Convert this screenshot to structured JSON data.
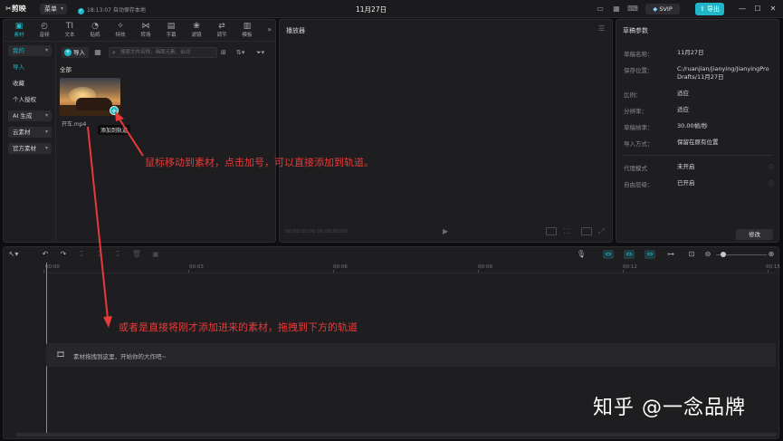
{
  "titlebar": {
    "app_name": "剪映",
    "menu_label": "菜单",
    "autosave_text": "18:13:07 自动保存本地",
    "doc_title": "11月27日",
    "svip_label": "SVIP",
    "export_label": "导出",
    "icons": [
      "monitor-icon",
      "layout-icon",
      "shortcut-icon"
    ],
    "window_controls": [
      "minimize-icon",
      "maximize-icon",
      "close-icon"
    ]
  },
  "media_tabs": [
    {
      "label": "素材",
      "icon": "media-icon",
      "active": true
    },
    {
      "label": "音频",
      "icon": "audio-icon"
    },
    {
      "label": "文本",
      "icon": "text-icon"
    },
    {
      "label": "贴纸",
      "icon": "sticker-icon"
    },
    {
      "label": "特效",
      "icon": "effects-icon"
    },
    {
      "label": "转场",
      "icon": "transition-icon"
    },
    {
      "label": "字幕",
      "icon": "subtitle-icon"
    },
    {
      "label": "滤镜",
      "icon": "filter-icon"
    },
    {
      "label": "调节",
      "icon": "adjust-icon"
    },
    {
      "label": "模板",
      "icon": "template-icon"
    }
  ],
  "side_nav": [
    {
      "label": "我的",
      "dropdown": true
    },
    {
      "label": "导入",
      "active": true
    },
    {
      "label": "收藏"
    },
    {
      "label": "个人授权"
    },
    {
      "label": "AI 生成",
      "dropdown": true
    },
    {
      "label": "云素材",
      "dropdown": true
    },
    {
      "label": "官方素材",
      "dropdown": true
    }
  ],
  "media_toolbar": {
    "import_label": "导入",
    "search_placeholder": "搜索文件名称、画面元素、台词"
  },
  "media": {
    "section_label": "全部",
    "clip_name": "开车.mp4",
    "tooltip": "添加到轨道"
  },
  "player": {
    "title": "播放器",
    "timecode": "00:00:00:00  00:00:00:00"
  },
  "props": {
    "title": "草稿参数",
    "rows": [
      {
        "key": "草稿名称：",
        "value": "11月27日"
      },
      {
        "key": "保存位置：",
        "value": "C:/ruanjian/jianying/JianyingPro Drafts/11月27日"
      },
      {
        "key": "比例：",
        "value": "适应"
      },
      {
        "key": "分辨率：",
        "value": "适应"
      },
      {
        "key": "草稿帧率：",
        "value": "30.00帧/秒"
      },
      {
        "key": "导入方式：",
        "value": "保留在原有位置"
      },
      {
        "key": "代理模式",
        "value": "未开启"
      },
      {
        "key": "自由层级：",
        "value": "已开启"
      }
    ],
    "modify_label": "修改"
  },
  "timeline": {
    "ruler_labels": [
      "00:00",
      "00:03",
      "00:06",
      "00:09",
      "00:12",
      "00:15"
    ],
    "drop_hint": "素材拖拽到这里，开始你的大作吧~"
  },
  "annotations": {
    "top": "鼠标移动到素材，点击加号，可以直接添加到轨道。",
    "bottom": "或者是直接将刚才添加进来的素材，拖拽到下方的轨道"
  },
  "watermark": "知乎 @一念品牌",
  "colors": {
    "accent": "#1fb7c8",
    "annotation": "#e83a3a",
    "background": "#0e0e10",
    "panel": "#1e1e21"
  }
}
